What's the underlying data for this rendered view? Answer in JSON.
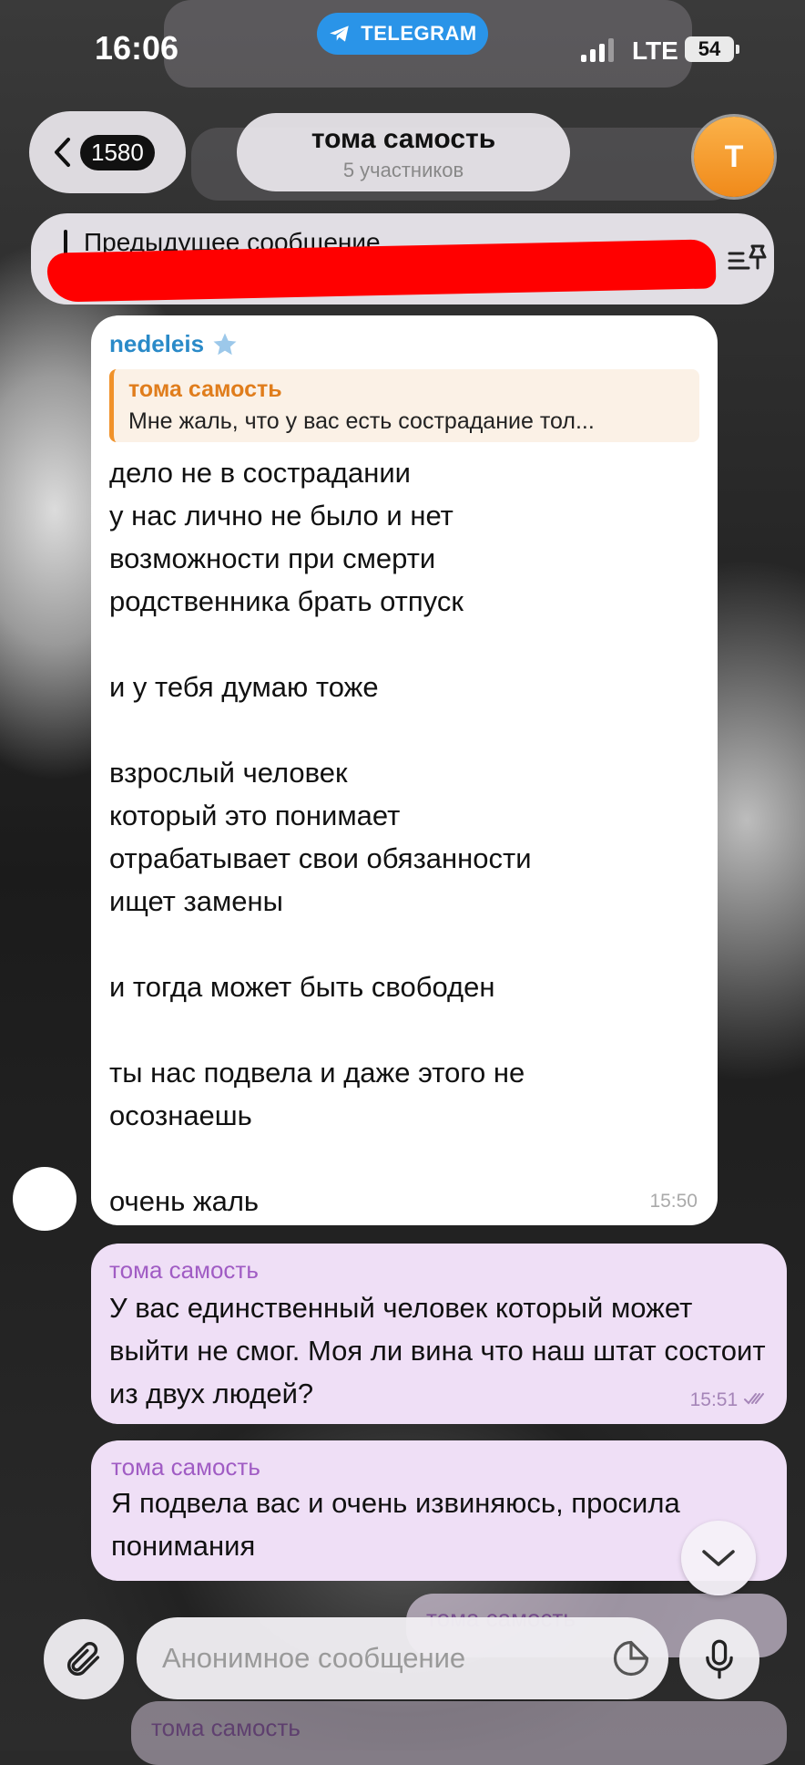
{
  "status_bar": {
    "time": "16:06",
    "app_pill": "TELEGRAM",
    "network": "LTE",
    "battery": "54"
  },
  "header": {
    "back_count": "1580",
    "chat_title": "тома самость",
    "chat_subtitle": "5 участников",
    "avatar_letter": "Т"
  },
  "pinned": {
    "title": "Предыдущее сообщение",
    "preview": "..."
  },
  "messages": [
    {
      "sender": "nedeleis",
      "reply_to": {
        "name": "тома самость",
        "text": "Мне жаль, что у вас есть сострадание тол..."
      },
      "text": "дело не в сострадании\nу нас лично не было и нет\nвозможности при смерти\nродственника брать отпуск\n\nи у тебя думаю тоже\n\nвзрослый человек\nкоторый это понимает\nотрабатывает свои обязанности\nищет замены\n\nи тогда может быть свободен\n\nты нас подвела и даже этого не\nосознаешь\n\nочень жаль",
      "time": "15:50"
    },
    {
      "sender": "тома самость",
      "text": "У вас единственный человек который может выйти не смог. Моя ли вина что наш штат состоит из двух людей?",
      "time": "15:51"
    },
    {
      "sender": "тома самость",
      "text": "Я подвела вас и очень извиняюсь, просила понимания"
    },
    {
      "sender": "тома самость"
    },
    {
      "sender": "тома самость"
    }
  ],
  "composer": {
    "placeholder": "Анонимное сообщение"
  },
  "colors": {
    "telegram_blue": "#2a94e8",
    "incoming_bubble": "#ffffff",
    "outgoing_bubble": "#efdff6",
    "sender_blue": "#2a8ac8",
    "sender_purple": "#a05cc4",
    "reply_orange": "#e07d1c",
    "redaction": "#ff0000"
  },
  "icons": {
    "back": "chevron-left-icon",
    "telegram": "telegram-icon",
    "pin": "pin-list-icon",
    "star": "star-icon",
    "attach": "paperclip-icon",
    "sticker": "sticker-icon",
    "mic": "microphone-icon",
    "scroll": "chevron-down-icon"
  }
}
